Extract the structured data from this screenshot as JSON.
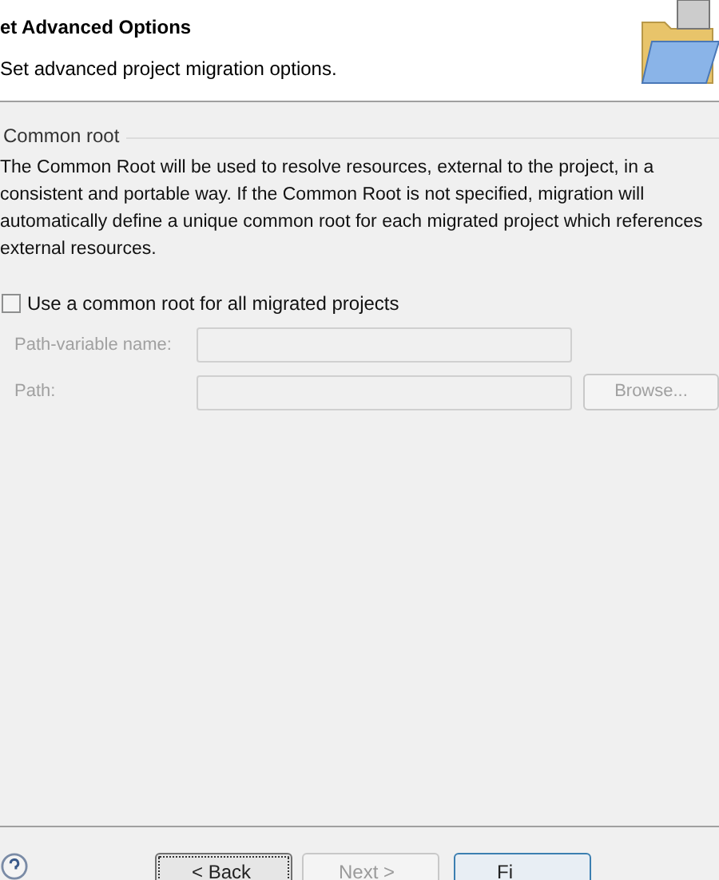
{
  "header": {
    "title": "et Advanced Options",
    "description": "Set advanced project migration options."
  },
  "group": {
    "title": "Common root",
    "description": "The Common Root will be used to resolve resources, external to the project, in a consistent and portable way. If the Common Root is not specified, migration will automatically define a unique common root for each migrated project which references external resources.",
    "checkbox": {
      "label": "Use a common root for all migrated projects",
      "checked": false
    },
    "fields": [
      {
        "label": "Path-variable name:",
        "disabled": true
      },
      {
        "label": "Path:",
        "disabled": true,
        "button": {
          "label": "Browse...",
          "disabled": true
        }
      }
    ]
  },
  "buttons": [
    {
      "label": "< Back",
      "disabled": false,
      "kind": "focused"
    },
    {
      "label": "Next >",
      "disabled": true,
      "kind": "normal"
    },
    {
      "label": "Fi",
      "disabled": false,
      "kind": "default"
    }
  ]
}
